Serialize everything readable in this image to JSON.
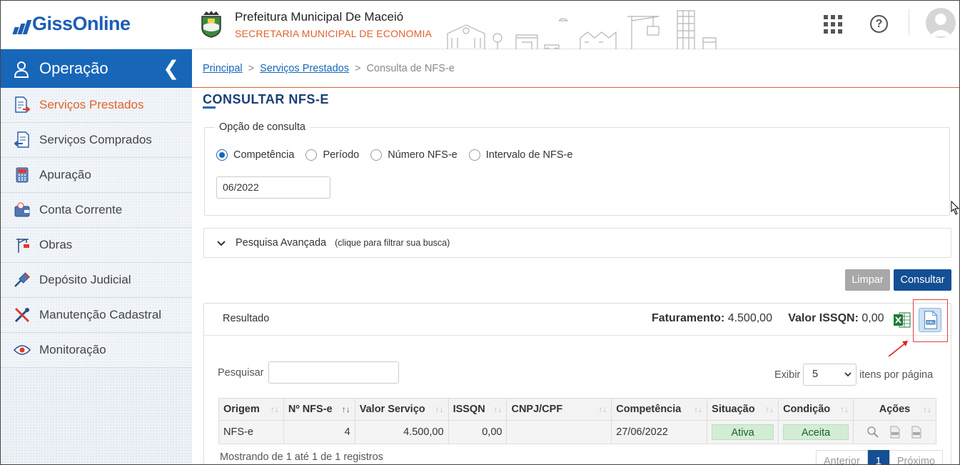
{
  "header": {
    "logo_text": "GissOnline",
    "prefeitura": "Prefeitura Municipal De Maceió",
    "secretaria": "SECRETARIA MUNICIPAL DE ECONOMIA",
    "help_glyph": "?"
  },
  "sidebar": {
    "title": "Operação",
    "collapse_glyph": "❮",
    "items": [
      {
        "label": "Serviços Prestados",
        "icon": "document-arrow-out-icon",
        "active": true
      },
      {
        "label": "Serviços Comprados",
        "icon": "document-arrow-in-icon",
        "active": false
      },
      {
        "label": "Apuração",
        "icon": "calculator-icon",
        "active": false
      },
      {
        "label": "Conta Corrente",
        "icon": "wallet-icon",
        "active": false
      },
      {
        "label": "Obras",
        "icon": "crane-icon",
        "active": false
      },
      {
        "label": "Depósito Judicial",
        "icon": "gavel-icon",
        "active": false
      },
      {
        "label": "Manutenção Cadastral",
        "icon": "tools-icon",
        "active": false
      },
      {
        "label": "Monitoração",
        "icon": "eye-icon",
        "active": false
      }
    ]
  },
  "breadcrumb": {
    "items": [
      "Principal",
      "Serviços Prestados",
      "Consulta de NFS-e"
    ],
    "separator": ">"
  },
  "page": {
    "title": "CONSULTAR NFS-E",
    "legend": "Opção de consulta",
    "options": [
      "Competência",
      "Período",
      "Número NFS-e",
      "Intervalo de NFS-e"
    ],
    "competencia_value": "06/2022",
    "advanced_label": "Pesquisa Avançada",
    "advanced_hint": "(clique para filtrar sua busca)",
    "limpar": "Limpar",
    "consultar": "Consultar"
  },
  "result": {
    "label": "Resultado",
    "faturamento_label": "Faturamento:",
    "faturamento_value": "4.500,00",
    "issqn_label": "Valor ISSQN:",
    "issqn_value": "0,00",
    "search_label": "Pesquisar",
    "search_value": "",
    "exibir_label": "Exibir",
    "page_size": "5",
    "itens_label": "itens por página",
    "columns": [
      "Origem",
      "Nº NFS-e",
      "Valor Serviço",
      "ISSQN",
      "CNPJ/CPF",
      "Competência",
      "Situação",
      "Condição",
      "Ações"
    ],
    "rows": [
      {
        "origem": "NFS-e",
        "numero": "4",
        "valor": "4.500,00",
        "issqn": "0,00",
        "cnpj": "",
        "competencia": "27/06/2022",
        "situacao": "Ativa",
        "condicao": "Aceita"
      }
    ],
    "footer": "Mostrando de 1 até 1 de 1 registros",
    "pager": {
      "prev": "Anterior",
      "current": "1",
      "next": "Próximo"
    }
  },
  "colors": {
    "brand": "#1766b8",
    "accent": "#e0632b",
    "primary_button": "#134f93",
    "success": "#d3edd5"
  }
}
